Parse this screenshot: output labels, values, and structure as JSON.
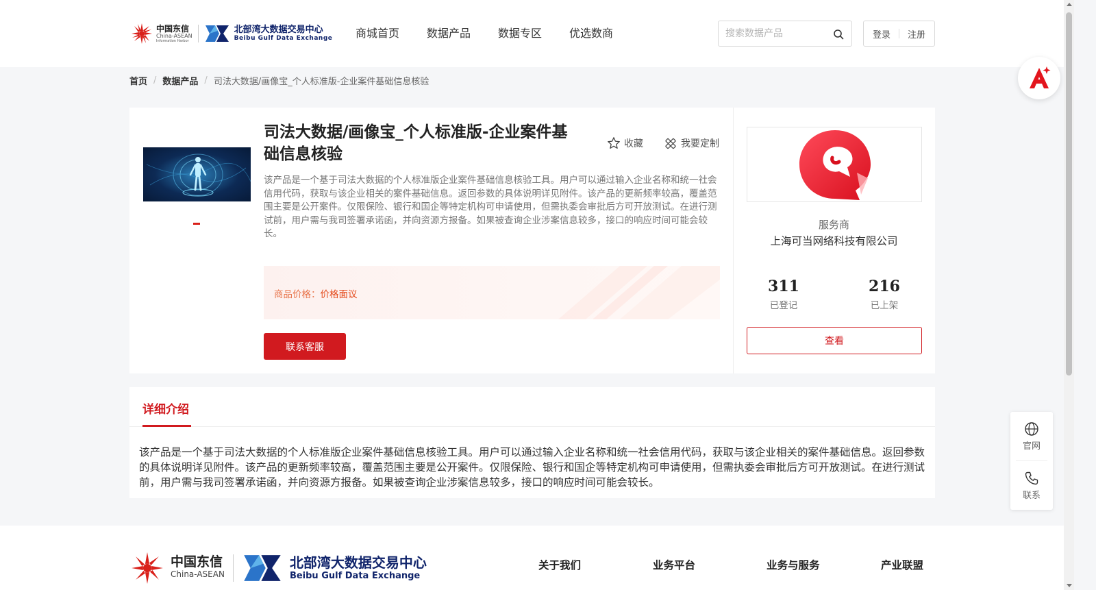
{
  "header": {
    "logo_ct_cn": "中国东信",
    "logo_ct_en": "China-ASEAN",
    "logo_ct_en2": "Information Harbor",
    "logo_bg_cn": "北部湾大数据交易中心",
    "logo_bg_en": "Beibu Gulf Data Exchange",
    "nav": [
      "商城首页",
      "数据产品",
      "数据专区",
      "优选数商"
    ],
    "search_placeholder": "搜索数据产品",
    "login": "登录",
    "register": "注册"
  },
  "breadcrumb": {
    "home": "首页",
    "category": "数据产品",
    "current": "司法大数据/画像宝_个人标准版-企业案件基础信息核验"
  },
  "product": {
    "title": "司法大数据/画像宝_个人标准版-企业案件基础信息核验",
    "favorite": "收藏",
    "customize": "我要定制",
    "description": "该产品是一个基于司法大数据的个人标准版企业案件基础信息核验工具。用户可以通过输入企业名称和统一社会信用代码，获取与该企业相关的案件基础信息。返回参数的具体说明详见附件。该产品的更新频率较高，覆盖范围主要是公开案件。仅限保险、银行和国企等特定机构可申请使用，但需执委会审批后方可开放测试。在进行测试前，用户需与我司签署承诺函，并向资源方报备。如果被查询企业涉案信息较多，接口的响应时间可能会较长。",
    "price_label": "商品价格：",
    "price_value": "价格面议",
    "contact_button": "联系客服"
  },
  "vendor": {
    "type_label": "服务商",
    "name": "上海可当网络科技有限公司",
    "registered_count": "311",
    "registered_label": "已登记",
    "listed_count": "216",
    "listed_label": "已上架",
    "view_button": "查看"
  },
  "detail": {
    "tab_label": "详细介绍",
    "text": "该产品是一个基于司法大数据的个人标准版企业案件基础信息核验工具。用户可以通过输入企业名称和统一社会信用代码，获取与该企业相关的案件基础信息。返回参数的具体说明详见附件。该产品的更新频率较高，覆盖范围主要是公开案件。仅限保险、银行和国企等特定机构可申请使用，但需执委会审批后方可开放测试。在进行测试前，用户需与我司签署承诺函，并向资源方报备。如果被查询企业涉案信息较多，接口的响应时间可能会较长。"
  },
  "side_tools": {
    "website": "官网",
    "contact": "联系"
  },
  "footer": {
    "logo_ct_cn": "中国东信",
    "logo_ct_en": "China-ASEAN",
    "logo_bg_cn": "北部湾大数据交易中心",
    "logo_bg_en": "Beibu Gulf Data Exchange",
    "nav": [
      "关于我们",
      "业务平台",
      "业务与服务",
      "产业联盟"
    ]
  },
  "colors": {
    "brand_red": "#d11a1f",
    "price_orange": "#e4491a",
    "brand_navy": "#10246b"
  }
}
